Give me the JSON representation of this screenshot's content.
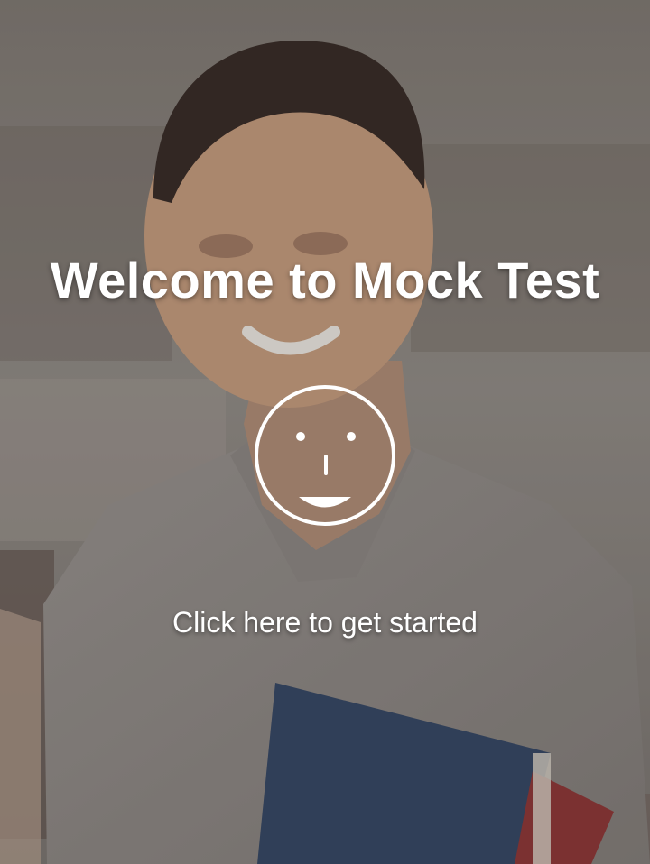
{
  "screen": {
    "title": "Welcome to Mock Test",
    "cta_label": "Click here to get started",
    "center_icon": "smiley-face-icon",
    "background": "student-with-books-photo"
  },
  "colors": {
    "text": "#ffffff",
    "overlay": "#46423e"
  }
}
